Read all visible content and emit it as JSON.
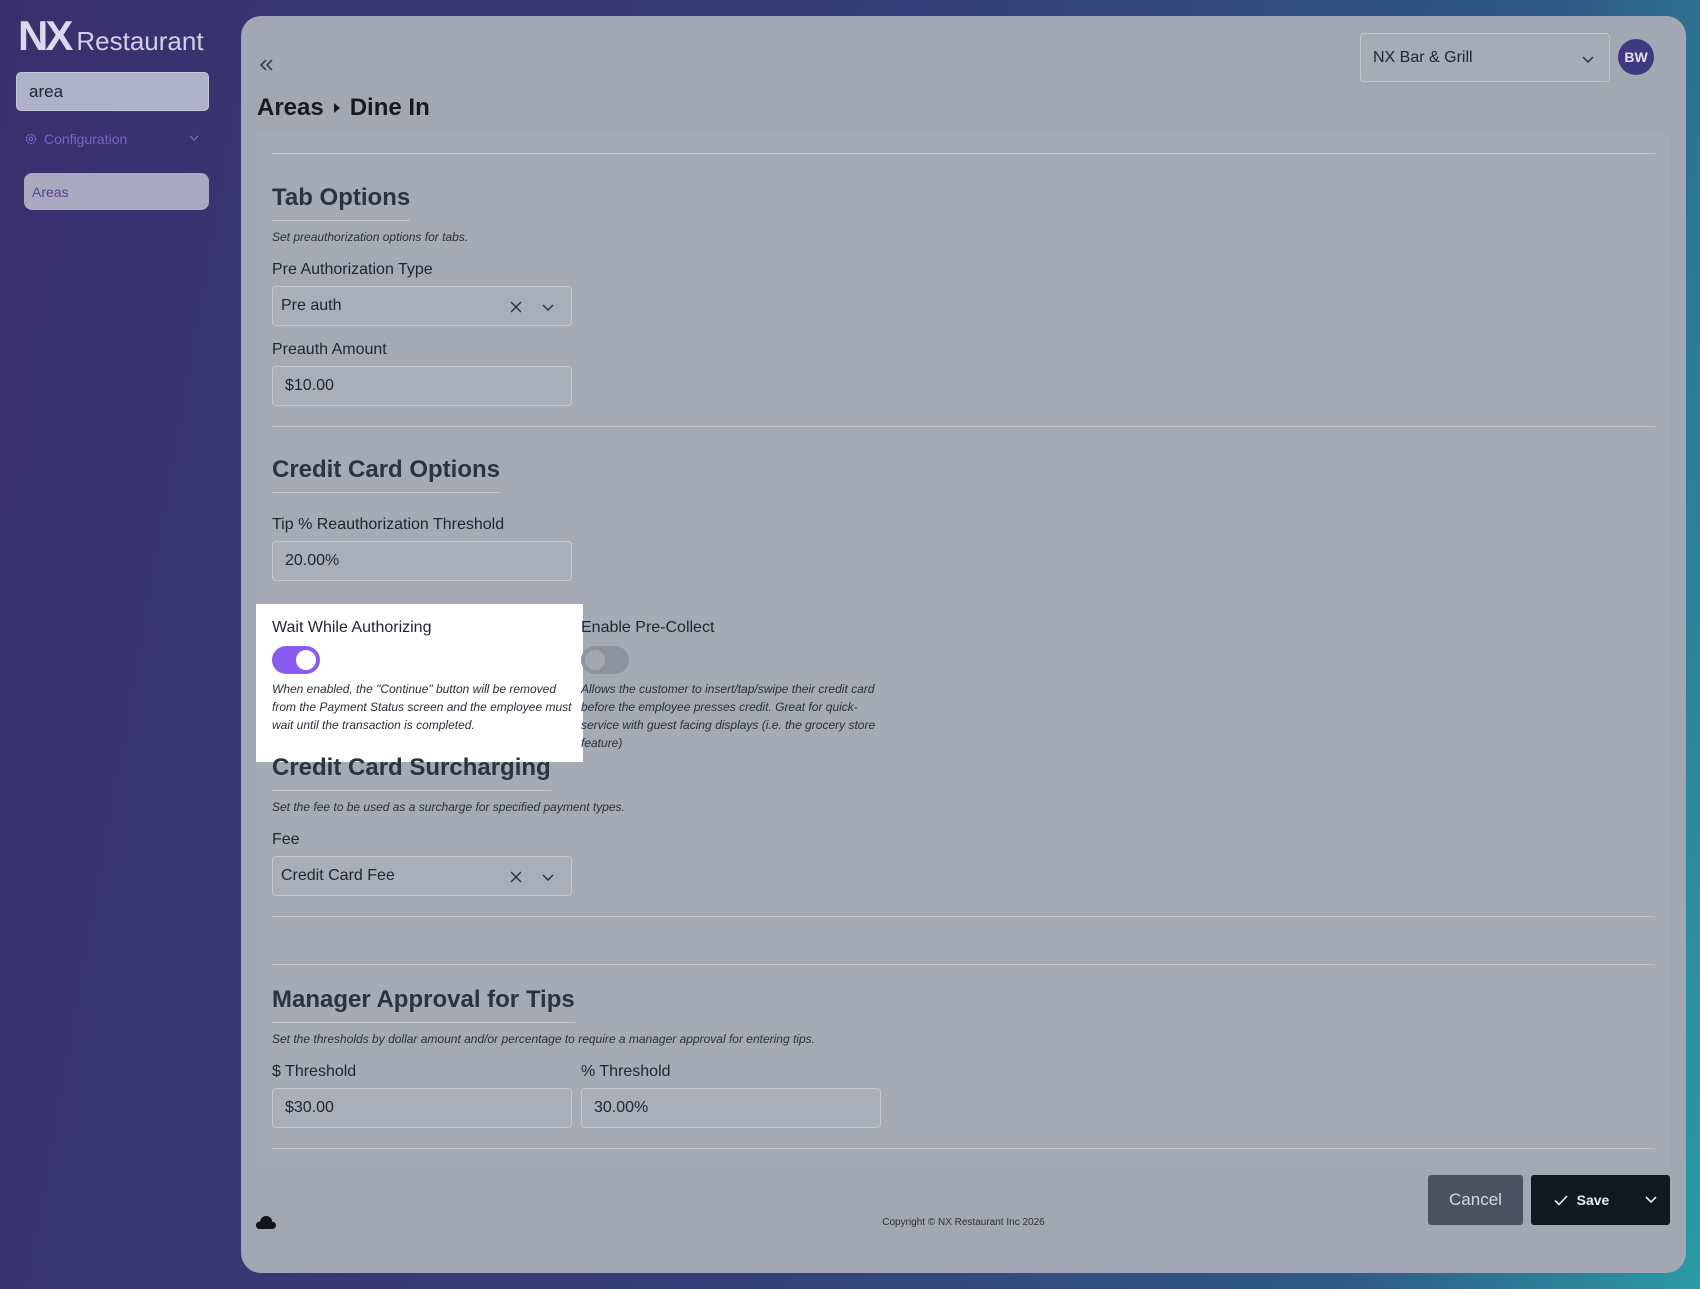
{
  "brand": {
    "mark": "NX",
    "name": "Restaurant"
  },
  "sidebar": {
    "search_value": "area",
    "group_label": "Configuration",
    "items": [
      {
        "label": "Areas"
      }
    ]
  },
  "header": {
    "venue": "NX Bar & Grill",
    "avatar_initials": "BW",
    "breadcrumb": [
      "Areas",
      "Dine In"
    ]
  },
  "tab_options": {
    "title": "Tab Options",
    "description": "Set preauthorization options for tabs.",
    "preauth_type_label": "Pre Authorization Type",
    "preauth_type_value": "Pre auth",
    "preauth_amount_label": "Preauth Amount",
    "preauth_amount_value": "$10.00"
  },
  "credit_card_options": {
    "title": "Credit Card Options",
    "tip_threshold_label": "Tip % Reauthorization Threshold",
    "tip_threshold_value": "20.00%",
    "wait_label": "Wait While Authorizing",
    "wait_enabled": true,
    "wait_help": "When enabled, the \"Continue\" button will be removed from the Payment Status screen and the employee must wait until the transaction is completed.",
    "precollect_label": "Enable Pre-Collect",
    "precollect_enabled": false,
    "precollect_help": "Allows the customer to insert/tap/swipe their credit card before the employee presses credit. Great for quick-service with guest facing displays (i.e. the grocery store feature)"
  },
  "surcharging": {
    "title": "Credit Card Surcharging",
    "description": "Set the fee to be used as a surcharge for specified payment types.",
    "fee_label": "Fee",
    "fee_value": "Credit Card Fee"
  },
  "manager_approval": {
    "title": "Manager Approval for Tips",
    "description": "Set the thresholds by dollar amount and/or percentage to require a manager approval for entering tips.",
    "dollar_label": "$ Threshold",
    "dollar_value": "$30.00",
    "percent_label": "% Threshold",
    "percent_value": "30.00%"
  },
  "footer": {
    "cancel_label": "Cancel",
    "save_label": "Save",
    "copyright": "Copyright © NX Restaurant Inc 2026"
  },
  "colors": {
    "accent": "#8b5cf0",
    "avatar": "#3f3a80",
    "save_button": "#121822",
    "cancel_button": "#4c5262"
  },
  "icons": [
    "gear-icon",
    "chevron-down-icon",
    "double-chevron-left-icon",
    "caret-right-icon",
    "close-icon",
    "check-icon",
    "cloud-icon"
  ]
}
